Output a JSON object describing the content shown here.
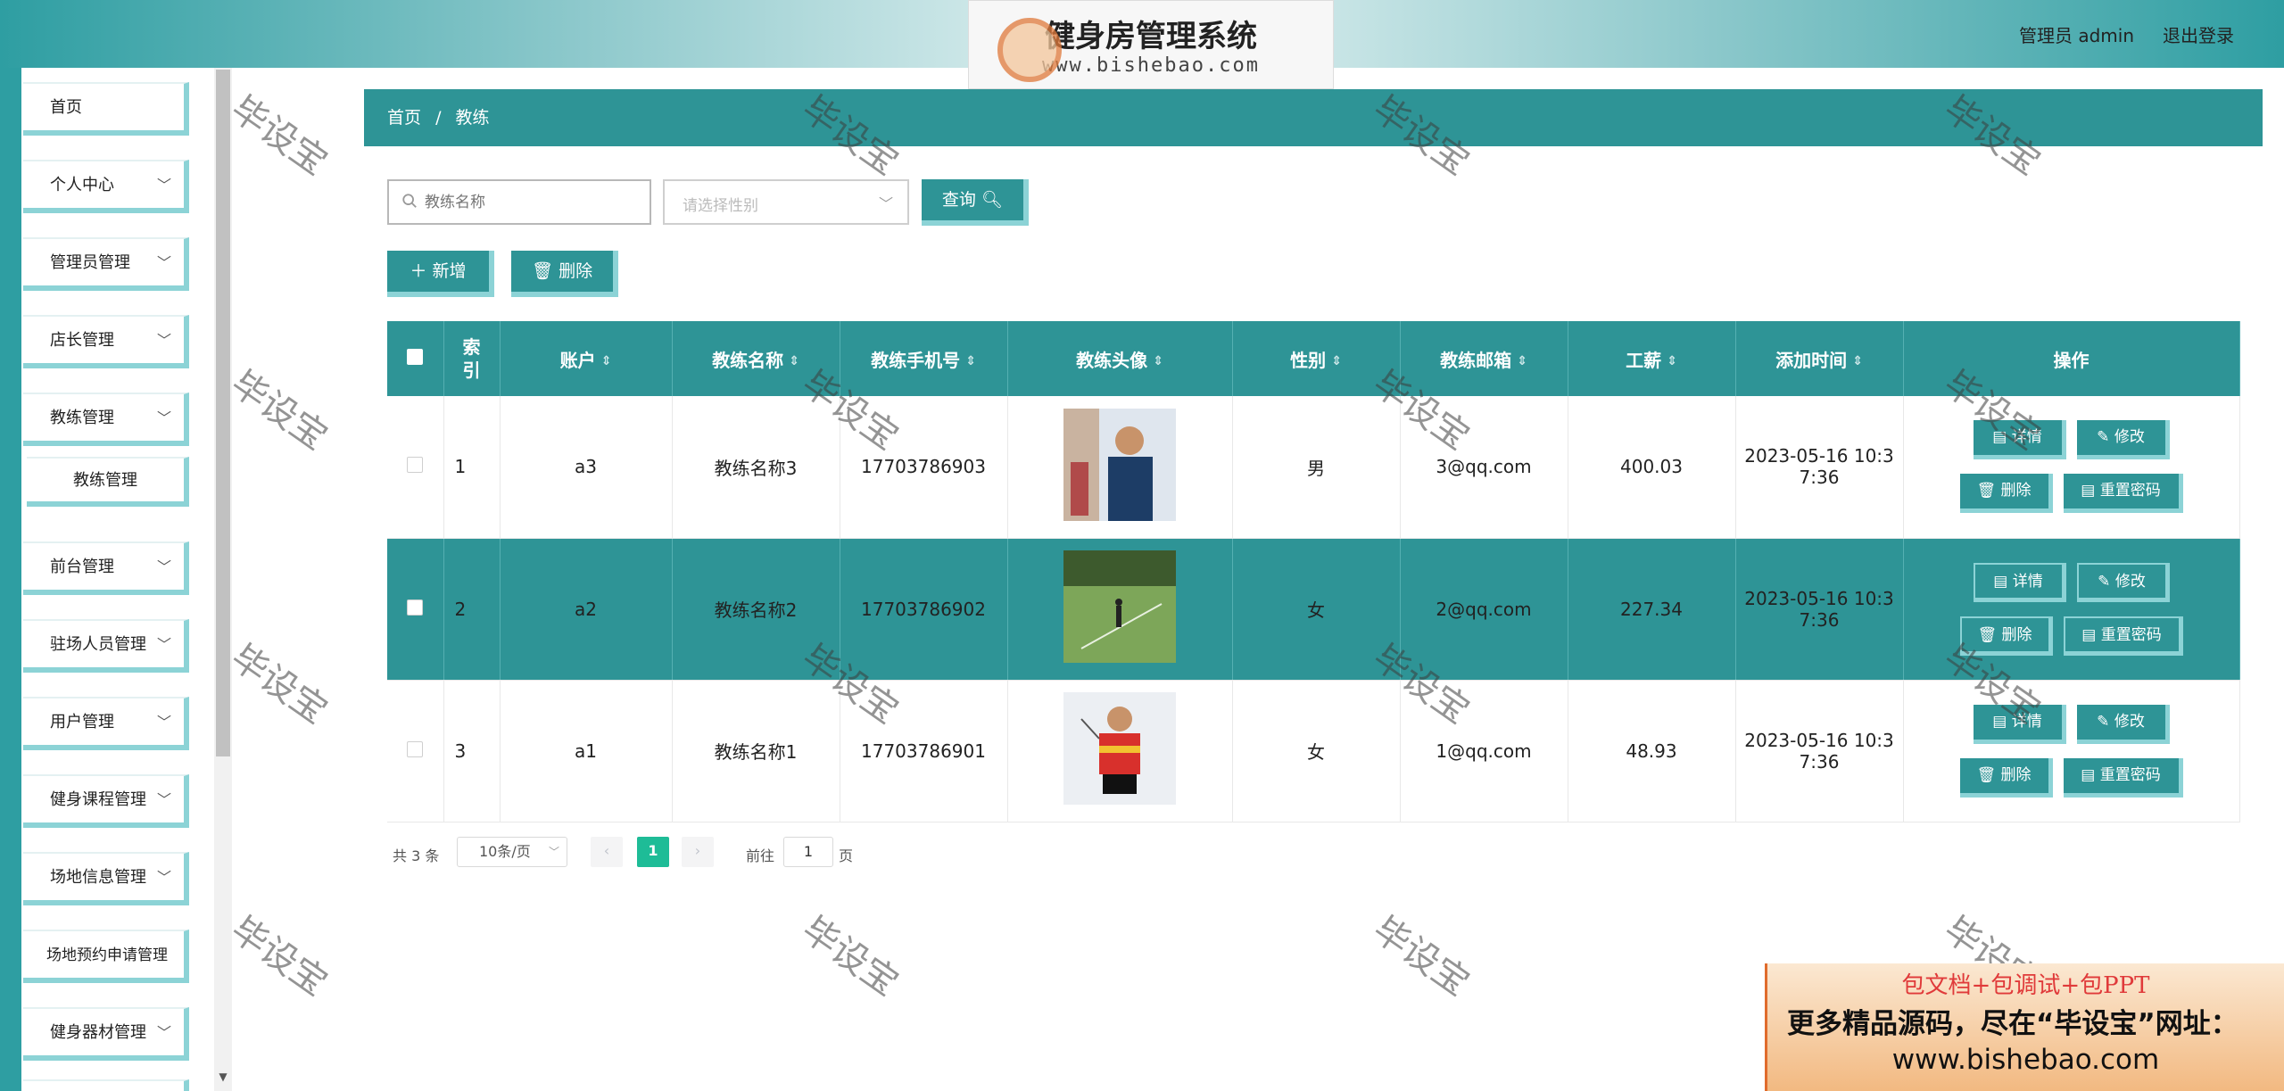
{
  "header": {
    "system_title": "健身房管理系统",
    "logo_url": "www.bishebao.com",
    "user_label": "管理员 admin",
    "logout_label": "退出登录"
  },
  "sidebar": {
    "items": [
      {
        "label": "首页",
        "has_children": false
      },
      {
        "label": "个人中心",
        "has_children": true
      },
      {
        "label": "管理员管理",
        "has_children": true
      },
      {
        "label": "店长管理",
        "has_children": true
      },
      {
        "label": "教练管理",
        "has_children": true
      },
      {
        "label": "前台管理",
        "has_children": true
      },
      {
        "label": "驻场人员管理",
        "has_children": true
      },
      {
        "label": "用户管理",
        "has_children": true
      },
      {
        "label": "健身课程管理",
        "has_children": true
      },
      {
        "label": "场地信息管理",
        "has_children": true
      },
      {
        "label": "场地预约申请管理",
        "has_children": false
      },
      {
        "label": "健身器材管理",
        "has_children": true
      }
    ],
    "submenu_label": "教练管理"
  },
  "breadcrumb": {
    "home": "首页",
    "separator": "/",
    "current": "教练"
  },
  "search": {
    "name_placeholder": "教练名称",
    "gender_placeholder": "请选择性别",
    "query_label": "查询"
  },
  "actions": {
    "add_label": "新增",
    "delete_label": "删除"
  },
  "table": {
    "headers": [
      "索引",
      "账户",
      "教练名称",
      "教练手机号",
      "教练头像",
      "性别",
      "教练邮箱",
      "工薪",
      "添加时间",
      "操作"
    ],
    "rows": [
      {
        "index": "1",
        "account": "a3",
        "name": "教练名称3",
        "phone": "17703786903",
        "gender": "男",
        "email": "3@qq.com",
        "salary": "400.03",
        "time_a": "2023-05-16 10:3",
        "time_b": "7:36"
      },
      {
        "index": "2",
        "account": "a2",
        "name": "教练名称2",
        "phone": "17703786902",
        "gender": "女",
        "email": "2@qq.com",
        "salary": "227.34",
        "time_a": "2023-05-16 10:3",
        "time_b": "7:36"
      },
      {
        "index": "3",
        "account": "a1",
        "name": "教练名称1",
        "phone": "17703786901",
        "gender": "女",
        "email": "1@qq.com",
        "salary": "48.93",
        "time_a": "2023-05-16 10:3",
        "time_b": "7:36"
      }
    ],
    "row_buttons": {
      "detail": "详情",
      "edit": "修改",
      "delete": "删除",
      "reset": "重置密码"
    }
  },
  "pagination": {
    "total": "共 3 条",
    "page_size": "10条/页",
    "current_page": "1",
    "goto_label": "前往",
    "goto_value": "1",
    "page_suffix": "页"
  },
  "watermark": "毕设宝",
  "promo": {
    "line1": "包文档+包调试+包PPT",
    "line2": "更多精品源码，尽在“毕设宝”网址：",
    "line3": "www.bishebao.com"
  },
  "colors": {
    "primary": "#2e9496",
    "accent_border": "#8cd3d6",
    "pager_active": "#1ebc97"
  }
}
